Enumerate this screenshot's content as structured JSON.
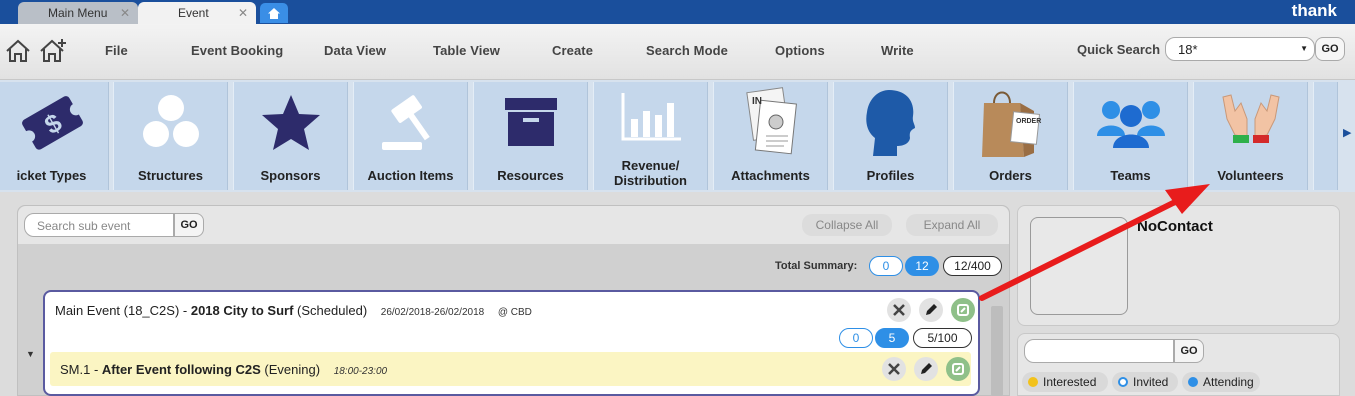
{
  "tabs": [
    {
      "label": "Main Menu",
      "close": "✕"
    },
    {
      "label": "Event",
      "close": "✕"
    }
  ],
  "brand": "thank",
  "menu": [
    "File",
    "Event Booking",
    "Data View",
    "Table View",
    "Create",
    "Search Mode",
    "Options",
    "Write"
  ],
  "quick_search": {
    "label": "Quick Search",
    "value": "18*",
    "go": "GO"
  },
  "tiles": [
    {
      "label": "icket Types",
      "icon": "ticket-icon"
    },
    {
      "label": "Structures",
      "icon": "structures-icon"
    },
    {
      "label": "Sponsors",
      "icon": "star-icon"
    },
    {
      "label": "Auction Items",
      "icon": "gavel-icon"
    },
    {
      "label": "Resources",
      "icon": "box-icon"
    },
    {
      "label": "Revenue/\nDistribution",
      "icon": "bar-chart-icon"
    },
    {
      "label": "Attachments",
      "icon": "attachments-icon"
    },
    {
      "label": "Profiles",
      "icon": "profile-head-icon"
    },
    {
      "label": "Orders",
      "icon": "shopping-bag-icon"
    },
    {
      "label": "Teams",
      "icon": "teams-icon"
    },
    {
      "label": "Volunteers",
      "icon": "raised-hands-icon"
    }
  ],
  "subevents": {
    "search_placeholder": "Search sub event",
    "go": "GO",
    "collapse_all": "Collapse All",
    "expand_all": "Expand All",
    "total_summary_label": "Total Summary:",
    "total": {
      "a": "0",
      "b": "12",
      "c": "12/400"
    }
  },
  "event": {
    "prefix": "Main Event (18_C2S) - ",
    "name": "2018 City to Surf",
    "status": " (Scheduled)",
    "dates": "26/02/2018-26/02/2018",
    "location": "@ CBD",
    "counts": {
      "a": "0",
      "b": "5",
      "c": "5/100"
    }
  },
  "sub_event": {
    "prefix": "SM.1 - ",
    "name": "After Event following C2S",
    "session": " (Evening)",
    "time": "18:00-23:00"
  },
  "contact": {
    "name": "NoContact"
  },
  "volunteers": {
    "go": "GO",
    "legend": [
      {
        "label": "Interested",
        "color": "#f2c21b",
        "hollow": false
      },
      {
        "label": "Invited",
        "color": "#2e8fe6",
        "hollow": true
      },
      {
        "label": "Attending",
        "color": "#2e8fe6",
        "hollow": false
      }
    ]
  },
  "colors": {
    "tabbar": "#1a4f9c",
    "accent": "#2e8fe6",
    "annotation_arrow": "#e81c1c"
  }
}
